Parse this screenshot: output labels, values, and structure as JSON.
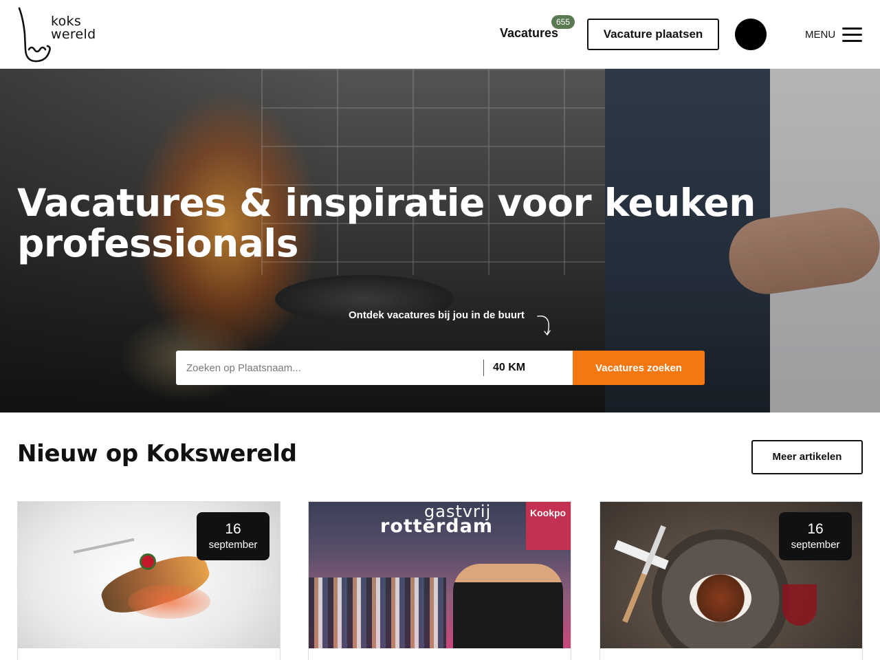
{
  "header": {
    "logo": {
      "line1": "koks",
      "line2": "wereld"
    },
    "nav_vacatures_label": "Vacatures",
    "vacatures_count": "655",
    "post_vacancy_label": "Vacature plaatsen",
    "menu_label": "MENU"
  },
  "hero": {
    "title": "Vacatures & inspiratie voor keuken professionals",
    "subtitle": "Ontdek vacatures bij jou in de buurt",
    "search": {
      "placeholder": "Zoeken op Plaatsnaam...",
      "radius": "40 KM",
      "button_label": "Vacatures zoeken"
    }
  },
  "news": {
    "title": "Nieuw op Kokswereld",
    "more_label": "Meer artikelen",
    "cards": [
      {
        "day": "16",
        "month": "september"
      },
      {
        "image_text_1": "gastvrij",
        "image_text_2": "rotterdam",
        "image_sign": "Kookpo"
      },
      {
        "day": "16",
        "month": "september"
      }
    ]
  },
  "colors": {
    "accent": "#f5770f",
    "badge": "#5a7a53",
    "text": "#111111"
  },
  "icons": [
    "hamburger-menu-icon",
    "curved-arrow-icon",
    "logo-ladle-icon"
  ]
}
